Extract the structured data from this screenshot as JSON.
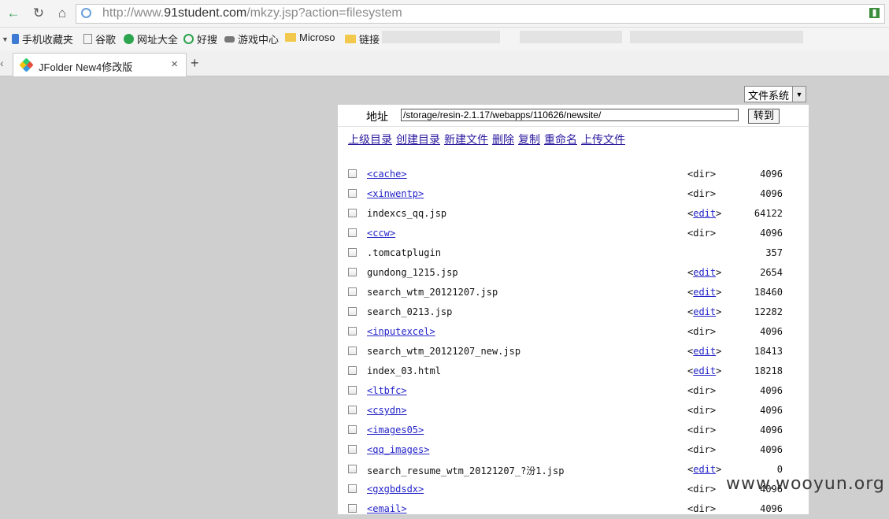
{
  "browser": {
    "url_prefix": "http://www.",
    "url_domain": "91student.com",
    "url_suffix": "/mkzy.jsp?action=filesystem",
    "bookmarks": [
      "手机收藏夹",
      "谷歌",
      "网址大全",
      "好搜",
      "游戏中心",
      "Microso",
      "链接"
    ],
    "tab_title": "JFolder New4修改版",
    "tab_close": "×",
    "tab_new": "+"
  },
  "filesystem": {
    "select_value": "文件系统",
    "address_label": "地址",
    "path": "/storage/resin-2.1.17/webapps/110626/newsite/",
    "go_label": "转到",
    "actions": [
      "上级目录",
      "创建目录",
      "新建文件",
      "删除",
      "复制",
      "重命名",
      "上传文件"
    ],
    "columns": [
      "name",
      "type",
      "size"
    ],
    "rows": [
      {
        "name": "<cache>",
        "is_dir": true,
        "type": "<dir>",
        "size": "4096"
      },
      {
        "name": "<xinwentp>",
        "is_dir": true,
        "type": "<dir>",
        "size": "4096"
      },
      {
        "name": "indexcs_qq.jsp",
        "is_dir": false,
        "type": "edit",
        "size": "64122"
      },
      {
        "name": "<ccw>",
        "is_dir": true,
        "type": "<dir>",
        "size": "4096"
      },
      {
        "name": ".tomcatplugin",
        "is_dir": false,
        "type": "",
        "size": "357"
      },
      {
        "name": "gundong_1215.jsp",
        "is_dir": false,
        "type": "edit",
        "size": "2654"
      },
      {
        "name": "search_wtm_20121207.jsp",
        "is_dir": false,
        "type": "edit",
        "size": "18460"
      },
      {
        "name": "search_0213.jsp",
        "is_dir": false,
        "type": "edit",
        "size": "12282"
      },
      {
        "name": "<inputexcel>",
        "is_dir": true,
        "type": "<dir>",
        "size": "4096"
      },
      {
        "name": "search_wtm_20121207_new.jsp",
        "is_dir": false,
        "type": "edit",
        "size": "18413"
      },
      {
        "name": "index_03.html",
        "is_dir": false,
        "type": "edit",
        "size": "18218"
      },
      {
        "name": "<ltbfc>",
        "is_dir": true,
        "type": "<dir>",
        "size": "4096"
      },
      {
        "name": "<csydn>",
        "is_dir": true,
        "type": "<dir>",
        "size": "4096"
      },
      {
        "name": "<images05>",
        "is_dir": true,
        "type": "<dir>",
        "size": "4096"
      },
      {
        "name": "<qq_images>",
        "is_dir": true,
        "type": "<dir>",
        "size": "4096"
      },
      {
        "name": "search_resume_wtm_20121207_?汾1.jsp",
        "is_dir": false,
        "type": "edit",
        "size": "0"
      },
      {
        "name": "<gxgbdsdx>",
        "is_dir": true,
        "type": "<dir>",
        "size": "4096"
      },
      {
        "name": "<email>",
        "is_dir": true,
        "type": "<dir>",
        "size": "4096"
      }
    ]
  },
  "watermark": "www.wooyun.org",
  "colors": {
    "link": "#2323c8",
    "action_link": "#2a1a9e",
    "page_bg": "#cfcfcf"
  }
}
